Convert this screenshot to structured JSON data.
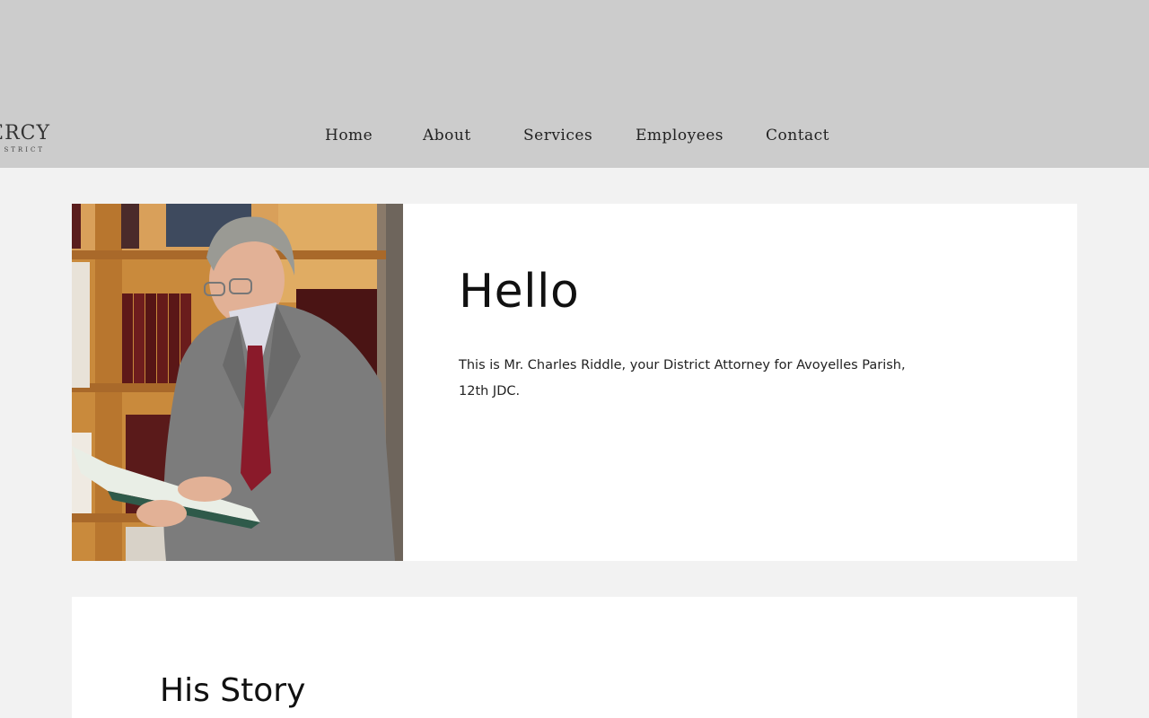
{
  "logo": {
    "main_text": "ERCY",
    "sub_text": "STRICT"
  },
  "nav": {
    "items": [
      {
        "label": "Home"
      },
      {
        "label": "About"
      },
      {
        "label": "Services"
      },
      {
        "label": "Employees"
      },
      {
        "label": "Contact"
      }
    ]
  },
  "hello": {
    "title": "Hello",
    "text": "This is Mr. Charles Riddle, your District Attorney for Avoyelles Parish, 12th JDC."
  },
  "story": {
    "title": "His Story"
  },
  "colors": {
    "header_bg": "#cccccc",
    "page_bg": "#f2f2f2",
    "card_bg": "#ffffff"
  }
}
